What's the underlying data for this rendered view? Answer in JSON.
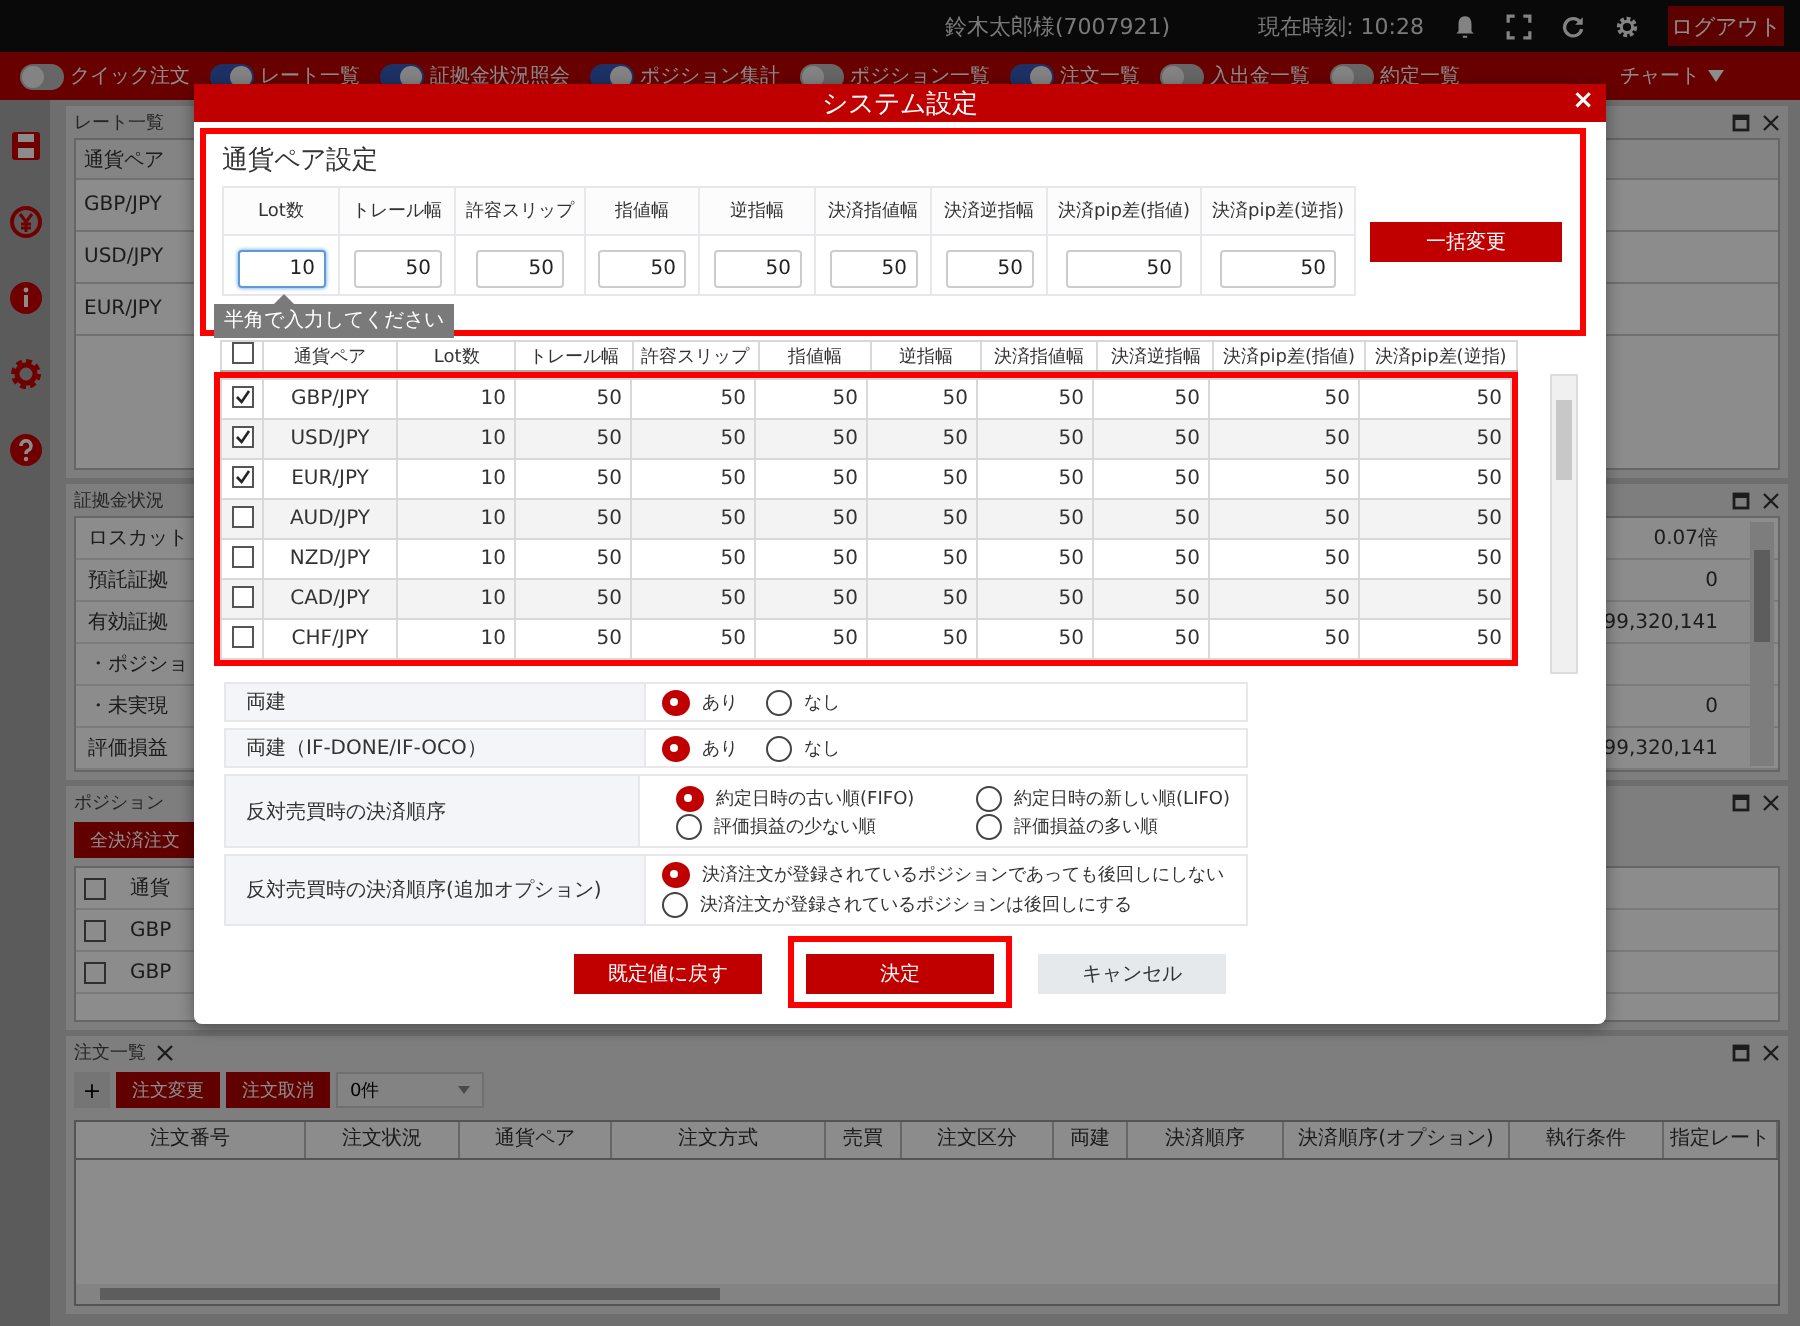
{
  "top_bar": {
    "user": "鈴木太郎様(7007921)",
    "clock": "現在時刻: 10:28",
    "logout": "ログアウト"
  },
  "toolbar": {
    "toggles": [
      {
        "label": "クイック注文",
        "on": false
      },
      {
        "label": "レート一覧",
        "on": true
      },
      {
        "label": "証拠金状況照会",
        "on": true
      },
      {
        "label": "ポジション集計",
        "on": true
      },
      {
        "label": "ポジション一覧",
        "on": false
      },
      {
        "label": "注文一覧",
        "on": true
      },
      {
        "label": "入出金一覧",
        "on": false
      },
      {
        "label": "約定一覧",
        "on": false
      }
    ],
    "menu": "チャート"
  },
  "rate_panel": {
    "title": "レート一覧",
    "column": "通貨ペア",
    "rows": [
      "GBP/JPY",
      "USD/JPY",
      "EUR/JPY"
    ]
  },
  "margin_panel": {
    "title": "証拠金状況",
    "rows": [
      {
        "label": "ロスカット",
        "value": "0.07倍"
      },
      {
        "label": "預託証拠",
        "value": "0"
      },
      {
        "label": "有効証拠",
        "value": "99,320,141"
      },
      {
        "label": "・ポジショ"
      },
      {
        "label": "・未実現",
        "value": "0"
      },
      {
        "label": "評価損益",
        "value": "99,320,141"
      }
    ]
  },
  "position_panel": {
    "title": "ポジション",
    "button": "全決済注文",
    "column": "通貨",
    "header_checked": false,
    "rows": [
      {
        "pair": "GBP",
        "checked": false
      },
      {
        "pair": "GBP",
        "checked": false
      }
    ]
  },
  "order_panel": {
    "title": "注文一覧",
    "add": "+",
    "buttons": [
      "注文変更",
      "注文取消"
    ],
    "count": "0件",
    "columns": [
      "注文番号",
      "注文状況",
      "通貨ペア",
      "注文方式",
      "売買",
      "注文区分",
      "両建",
      "決済順序",
      "決済順序(オプション)",
      "執行条件",
      "指定レート"
    ]
  },
  "dialog": {
    "title": "システム設定",
    "close": "×",
    "pair_settings": {
      "title": "通貨ペア設定",
      "highlighted": true,
      "apply": "一括変更",
      "hint": "半角で入力してください",
      "fields": [
        {
          "label": "Lot数",
          "value": "10",
          "focused": true
        },
        {
          "label": "トレール幅",
          "value": "50",
          "focused": false
        },
        {
          "label": "許容スリップ",
          "value": "50",
          "focused": false
        },
        {
          "label": "指値幅",
          "value": "50",
          "focused": false
        },
        {
          "label": "逆指幅",
          "value": "50",
          "focused": false
        },
        {
          "label": "決済指値幅",
          "value": "50",
          "focused": false
        },
        {
          "label": "決済逆指幅",
          "value": "50",
          "focused": false
        },
        {
          "label": "決済pip差(指値)",
          "value": "50",
          "focused": false
        },
        {
          "label": "決済pip差(逆指)",
          "value": "50",
          "focused": false
        }
      ]
    },
    "grid": {
      "highlighted": true,
      "header_checked": false,
      "columns": [
        "通貨ペア",
        "Lot数",
        "トレール幅",
        "許容スリップ",
        "指値幅",
        "逆指幅",
        "決済指値幅",
        "決済逆指幅",
        "決済pip差(指値)",
        "決済pip差(逆指)"
      ],
      "rows": [
        {
          "checked": true,
          "cells": [
            "GBP/JPY",
            "10",
            "50",
            "50",
            "50",
            "50",
            "50",
            "50",
            "50",
            "50"
          ]
        },
        {
          "checked": true,
          "cells": [
            "USD/JPY",
            "10",
            "50",
            "50",
            "50",
            "50",
            "50",
            "50",
            "50",
            "50"
          ]
        },
        {
          "checked": true,
          "cells": [
            "EUR/JPY",
            "10",
            "50",
            "50",
            "50",
            "50",
            "50",
            "50",
            "50",
            "50"
          ]
        },
        {
          "checked": false,
          "cells": [
            "AUD/JPY",
            "10",
            "50",
            "50",
            "50",
            "50",
            "50",
            "50",
            "50",
            "50"
          ]
        },
        {
          "checked": false,
          "cells": [
            "NZD/JPY",
            "10",
            "50",
            "50",
            "50",
            "50",
            "50",
            "50",
            "50",
            "50"
          ]
        },
        {
          "checked": false,
          "cells": [
            "CAD/JPY",
            "10",
            "50",
            "50",
            "50",
            "50",
            "50",
            "50",
            "50",
            "50"
          ]
        },
        {
          "checked": false,
          "cells": [
            "CHF/JPY",
            "10",
            "50",
            "50",
            "50",
            "50",
            "50",
            "50",
            "50",
            "50"
          ]
        }
      ]
    },
    "options": [
      {
        "label": "両建",
        "kind": "inline",
        "choices": [
          {
            "label": "あり",
            "selected": true
          },
          {
            "label": "なし",
            "selected": false
          }
        ]
      },
      {
        "label": "両建（IF-DONE/IF-OCO）",
        "kind": "inline",
        "choices": [
          {
            "label": "あり",
            "selected": true
          },
          {
            "label": "なし",
            "selected": false
          }
        ]
      },
      {
        "label": "反対売買時の決済順序",
        "kind": "grid",
        "choices": [
          {
            "label": "約定日時の古い順(FIFO)",
            "selected": true
          },
          {
            "label": "約定日時の新しい順(LIFO)",
            "selected": false
          },
          {
            "label": "評価損益の少ない順",
            "selected": false
          },
          {
            "label": "評価損益の多い順",
            "selected": false
          }
        ]
      },
      {
        "label": "反対売買時の決済順序(追加オプション)",
        "kind": "stack",
        "choices": [
          {
            "label": "決済注文が登録されているポジションであっても後回しにしない",
            "selected": true
          },
          {
            "label": "決済注文が登録されているポジションは後回しにする",
            "selected": false
          }
        ]
      }
    ],
    "buttons": [
      {
        "label": "既定値に戻す",
        "kind": "default",
        "highlighted": false
      },
      {
        "label": "決定",
        "kind": "primary",
        "highlighted": true
      },
      {
        "label": "キャンセル",
        "kind": "cancel",
        "highlighted": false
      }
    ]
  }
}
